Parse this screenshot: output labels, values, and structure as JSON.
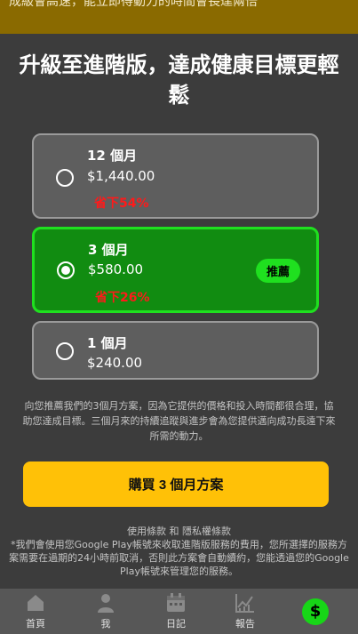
{
  "banner": {
    "text": "成級會高速，能立即得動力的時間會長達兩倍"
  },
  "title": "升級至進階版，達成健康目標更輕鬆",
  "plans": [
    {
      "name": "12 個月",
      "price": "$1,440.00",
      "save": "省下54%",
      "selected": false
    },
    {
      "name": "3 個月",
      "price": "$580.00",
      "save": "省下26%",
      "selected": true,
      "badge": "推薦"
    },
    {
      "name": "1 個月",
      "price": "$240.00",
      "selected": false
    }
  ],
  "recommend_text": "向您推薦我們的3個月方案，因為它提供的價格和投入時間都很合理，協助您達成目標。三個月來的持續追蹤與進步會為您提供邁向成功長遠下來所需的動力。",
  "buy_button_label": "購買 3 個月方案",
  "terms": {
    "links": "使用條款 和 隱私權條款",
    "body": "*我們會使用您Google Play帳號來收取進階版服務的費用，您所選擇的服務方案需要在過期的24小時前取消，否則此方案會自動續約，您能透過您的Google Play帳號來管理您的服務。"
  },
  "nav": {
    "home": "首頁",
    "me": "我",
    "diary": "日記",
    "report": "報告",
    "premium_symbol": "$"
  },
  "colors": {
    "accent": "#ffc107",
    "selected_plan": "#118c11",
    "selected_border": "#1fe01f",
    "discount": "#ff1a1a",
    "background": "#3c3c3c"
  }
}
